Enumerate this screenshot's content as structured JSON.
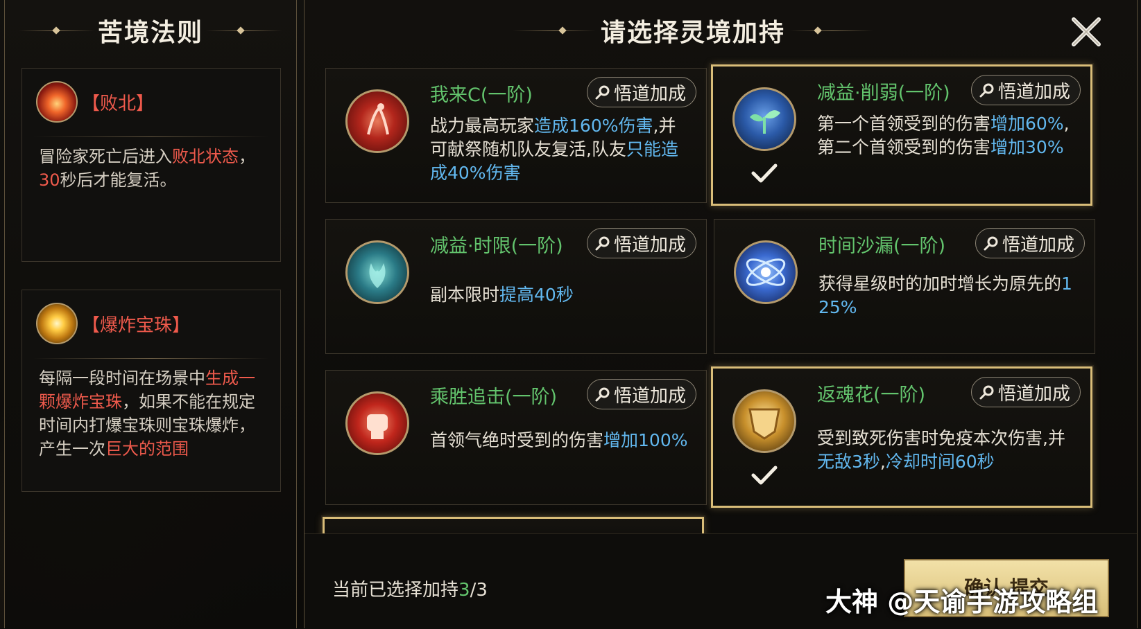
{
  "left": {
    "title": "苦境法则",
    "rules": [
      {
        "name": "【败北】",
        "icon": "flame-hand-icon",
        "segments": [
          {
            "text": "冒险家死亡后进入",
            "style": "normal"
          },
          {
            "text": "败北状态",
            "style": "red"
          },
          {
            "text": "，",
            "style": "normal"
          },
          {
            "text": "30",
            "style": "red"
          },
          {
            "text": "秒后才能复活。",
            "style": "normal"
          }
        ]
      },
      {
        "name": "【爆炸宝珠】",
        "icon": "glowing-orb-icon",
        "segments": [
          {
            "text": "每隔一段时间在场景中",
            "style": "normal"
          },
          {
            "text": "生成一颗爆炸宝珠",
            "style": "red"
          },
          {
            "text": "，如果不能在规定时间内打爆宝珠则宝珠爆炸，产生一次",
            "style": "normal"
          },
          {
            "text": "巨大的范围",
            "style": "red"
          }
        ]
      }
    ]
  },
  "right": {
    "title": "请选择灵境加持",
    "insight_label": "悟道加成",
    "buffs": [
      {
        "name": "我来C(一阶)",
        "icon": "sacrifice-icon",
        "selected": false,
        "segments": [
          {
            "text": "战力最高玩家",
            "style": "normal"
          },
          {
            "text": "造成160%伤害",
            "style": "blue"
          },
          {
            "text": ",并可献祭随机队友复活,队友",
            "style": "normal"
          },
          {
            "text": "只能造成40%伤害",
            "style": "blue"
          }
        ]
      },
      {
        "name": "减益·削弱(一阶)",
        "icon": "sprout-icon",
        "selected": true,
        "segments": [
          {
            "text": "第一个首领受到的伤害",
            "style": "normal"
          },
          {
            "text": "增加60%",
            "style": "blue"
          },
          {
            "text": ",第二个首领受到的伤害",
            "style": "normal"
          },
          {
            "text": "增加30%",
            "style": "blue"
          }
        ]
      },
      {
        "name": "减益·时限(一阶)",
        "icon": "spirit-flame-icon",
        "selected": false,
        "segments": [
          {
            "text": "副本限时",
            "style": "normal"
          },
          {
            "text": "提高40秒",
            "style": "blue"
          }
        ]
      },
      {
        "name": "时间沙漏(一阶)",
        "icon": "orbit-icon",
        "selected": false,
        "segments": [
          {
            "text": "获得星级时的加时增长为原先的",
            "style": "normal"
          },
          {
            "text": "125%",
            "style": "blue"
          }
        ]
      },
      {
        "name": "乘胜追击(一阶)",
        "icon": "fist-icon",
        "selected": false,
        "segments": [
          {
            "text": "首领气绝时受到的伤害",
            "style": "normal"
          },
          {
            "text": "增加100%",
            "style": "blue"
          }
        ]
      },
      {
        "name": "返魂花(一阶)",
        "icon": "golden-shield-icon",
        "selected": true,
        "segments": [
          {
            "text": "受到致死伤害时免疫本次伤害,并",
            "style": "normal"
          },
          {
            "text": "无敌3秒",
            "style": "blue"
          },
          {
            "text": ",",
            "style": "normal"
          },
          {
            "text": "冷却时间60秒",
            "style": "blue"
          }
        ]
      }
    ],
    "status_prefix": "当前已选择加持",
    "selected_count": "3",
    "status_suffix": "/3",
    "confirm_label": "确认 提交"
  },
  "watermark": "大神 @天谕手游攻略组",
  "colors": {
    "accent_gold": "#d9bd79",
    "highlight_red": "#ef5a4c",
    "highlight_blue": "#62b8ef",
    "name_green": "#63c46d"
  }
}
